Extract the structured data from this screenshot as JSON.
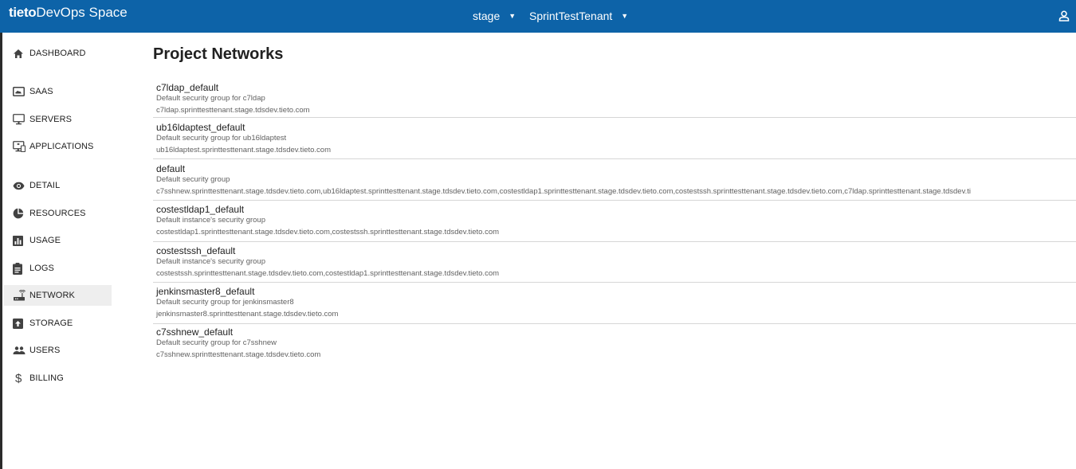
{
  "app": {
    "brand_bold": "tieto",
    "brand_rest": "DevOps Space"
  },
  "header": {
    "environment": "stage",
    "tenant": "SprintTestTenant",
    "user_icon": "user-icon",
    "caret_icon": "caret-down-icon"
  },
  "sidebar": {
    "items": [
      {
        "label": "DASHBOARD",
        "icon": "home-icon"
      },
      {
        "label": "SAAS",
        "icon": "cloud-icon"
      },
      {
        "label": "SERVERS",
        "icon": "monitor-icon"
      },
      {
        "label": "APPLICATIONS",
        "icon": "applications-icon"
      },
      {
        "label": "DETAIL",
        "icon": "eye-icon"
      },
      {
        "label": "RESOURCES",
        "icon": "pie-chart-icon"
      },
      {
        "label": "USAGE",
        "icon": "bar-chart-icon"
      },
      {
        "label": "LOGS",
        "icon": "clipboard-icon"
      },
      {
        "label": "NETWORK",
        "icon": "network-icon",
        "active": true
      },
      {
        "label": "STORAGE",
        "icon": "storage-icon"
      },
      {
        "label": "USERS",
        "icon": "users-icon"
      },
      {
        "label": "BILLING",
        "icon": "dollar-icon"
      }
    ]
  },
  "main": {
    "title": "Project Networks",
    "networks": [
      {
        "name": "c7ldap_default",
        "description": "Default security group for c7ldap",
        "hosts": "c7ldap.sprinttesttenant.stage.tdsdev.tieto.com"
      },
      {
        "name": "ub16ldaptest_default",
        "description": "Default security group for ub16ldaptest",
        "hosts": "ub16ldaptest.sprinttesttenant.stage.tdsdev.tieto.com"
      },
      {
        "name": "default",
        "description": "Default security group",
        "hosts": "c7sshnew.sprinttesttenant.stage.tdsdev.tieto.com,ub16ldaptest.sprinttesttenant.stage.tdsdev.tieto.com,costestldap1.sprinttesttenant.stage.tdsdev.tieto.com,costestssh.sprinttesttenant.stage.tdsdev.tieto.com,c7ldap.sprinttesttenant.stage.tdsdev.ti"
      },
      {
        "name": "costestldap1_default",
        "description": "Default instance's security group",
        "hosts": "costestldap1.sprinttesttenant.stage.tdsdev.tieto.com,costestssh.sprinttesttenant.stage.tdsdev.tieto.com"
      },
      {
        "name": "costestssh_default",
        "description": "Default instance's security group",
        "hosts": "costestssh.sprinttesttenant.stage.tdsdev.tieto.com,costestldap1.sprinttesttenant.stage.tdsdev.tieto.com"
      },
      {
        "name": "jenkinsmaster8_default",
        "description": "Default security group for jenkinsmaster8",
        "hosts": "jenkinsmaster8.sprinttesttenant.stage.tdsdev.tieto.com"
      },
      {
        "name": "c7sshnew_default",
        "description": "Default security group for c7sshnew",
        "hosts": "c7sshnew.sprinttesttenant.stage.tdsdev.tieto.com"
      }
    ]
  },
  "colors": {
    "header_bg": "#0d63a8",
    "active_nav_bg": "#eeeeee",
    "separator": "#d6d6d6"
  }
}
